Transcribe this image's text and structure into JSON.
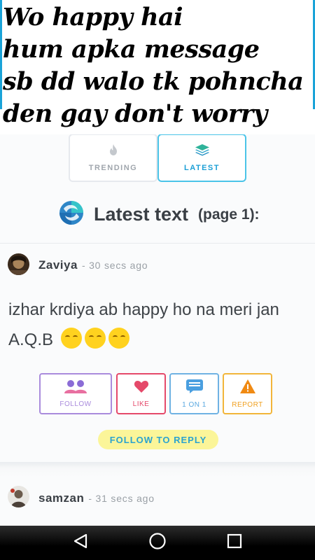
{
  "caption": {
    "lines": [
      "Wo happy hai",
      "hum apka message",
      "sb dd walo tk pohncha",
      "den gay don't worry"
    ]
  },
  "tabs": [
    {
      "label": "TRENDING",
      "icon": "flame-icon",
      "active": false
    },
    {
      "label": "LATEST",
      "icon": "layers-icon",
      "active": true
    }
  ],
  "section": {
    "title": "Latest text",
    "suffix": "(page 1):"
  },
  "posts": [
    {
      "author": "Zaviya",
      "time": "- 30 secs ago",
      "text": "izhar krdiya ab happy ho na meri jan A.Q.B",
      "emojis": [
        "kissing-face-emoji",
        "kissing-face-emoji",
        "kissing-face-emoji"
      ],
      "actions": [
        {
          "label": "FOLLOW",
          "icon": "users-icon",
          "color": "#9c7bd6"
        },
        {
          "label": "LIKE",
          "icon": "heart-icon",
          "color": "#e5496a"
        },
        {
          "label": "1 ON 1",
          "icon": "chat-icon",
          "color": "#5aa8e0"
        },
        {
          "label": "REPORT",
          "icon": "warning-icon",
          "color": "#f2a81d"
        }
      ],
      "reply_label": "FOLLOW TO REPLY"
    },
    {
      "author": "samzan",
      "time": "- 31 secs ago"
    }
  ],
  "colors": {
    "accent": "#4bc4e8",
    "reply_bg": "#fbf599",
    "text": "#3e4348"
  },
  "navbar": {
    "icons": [
      "back-icon",
      "home-icon",
      "recents-icon"
    ]
  }
}
